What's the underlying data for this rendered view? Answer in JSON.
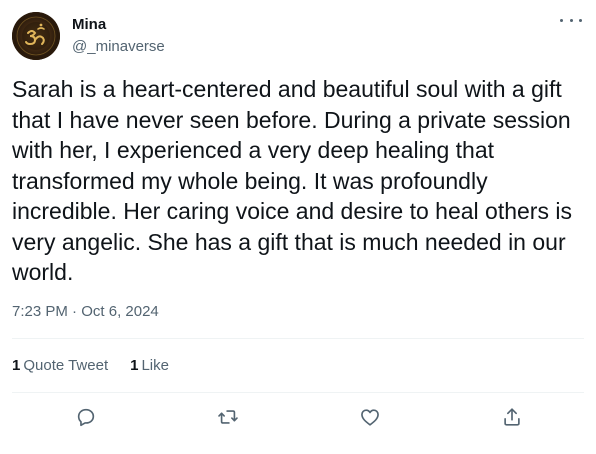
{
  "author": {
    "name": "Mina",
    "handle": "@_minaverse",
    "avatar_icon": "om-symbol-icon"
  },
  "tweet": {
    "text": "Sarah is a heart-centered and beautiful soul with a gift\nthat I have never seen before. During a private session\nwith her, I experienced a very deep healing that\ntransformed my whole being. It was profoundly\nincredible. Her caring voice and desire to heal others is\nvery angelic. She has a gift that is much needed in our\nworld.",
    "time": "7:23 PM",
    "separator": "·",
    "date": "Oct 6, 2024"
  },
  "stats": {
    "quote_tweets": {
      "count": "1",
      "label": "Quote Tweet"
    },
    "likes": {
      "count": "1",
      "label": "Like"
    }
  },
  "actions": [
    {
      "name": "reply",
      "icon": "reply-icon"
    },
    {
      "name": "retweet",
      "icon": "retweet-icon"
    },
    {
      "name": "like",
      "icon": "heart-icon"
    },
    {
      "name": "share",
      "icon": "share-icon"
    }
  ],
  "colors": {
    "text_primary": "#0f1419",
    "text_secondary": "#536471",
    "divider": "#eff3f4"
  }
}
